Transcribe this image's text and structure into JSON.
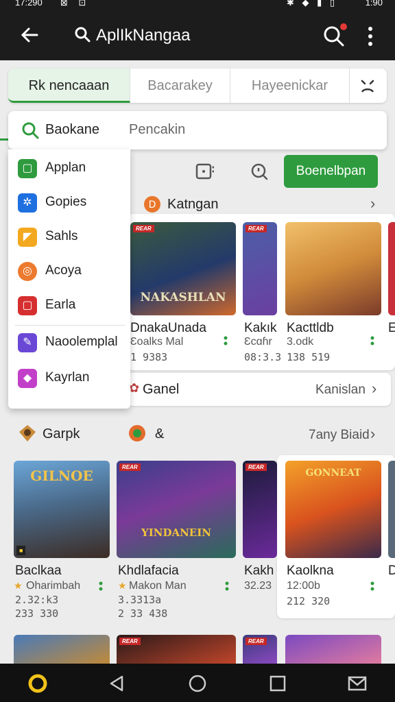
{
  "status": {
    "time_left": "17:290",
    "time_right": "1:90",
    "icons_left": "⊠ ⊡",
    "icons_right": "✱ ◆ ▮ ▯"
  },
  "app_bar": {
    "title": "AplIkNangaa"
  },
  "tabs": [
    "Rk nencaaan",
    "Bacarakey",
    "Hayeenickar"
  ],
  "search": {
    "chip": "Baokane",
    "placeholder": "Pencakin"
  },
  "dropdown": [
    {
      "label": "Applan",
      "color": "#2e9b3e",
      "icon": "square-icon"
    },
    {
      "label": "Gopies",
      "color": "#1e6fe0",
      "icon": "puzzle-icon"
    },
    {
      "label": "Sahls",
      "color": "#f3a91f",
      "icon": "play-icon"
    },
    {
      "label": "Acoya",
      "color": "#ec7a2f",
      "icon": "circle-icon"
    },
    {
      "label": "Earla",
      "color": "#d62f2f",
      "icon": "square-icon"
    },
    {
      "label": "Naoolemplal",
      "color": "#6b47d6",
      "icon": "pen-icon"
    },
    {
      "label": "Kayrlan",
      "color": "#c23fc9",
      "icon": "diamond-icon"
    }
  ],
  "go_button": "Boenelbpan",
  "section1": {
    "title": "Katngan",
    "cards": [
      {
        "name": "DnakaUnada",
        "sub": "Ɛoalks Mal",
        "num": "1 9383",
        "logo": "NAKASHLAN",
        "badge": "REAR"
      },
      {
        "name": "Kakık",
        "sub": "Ɛcɑɦr",
        "num": "08:3.3",
        "logo": "",
        "badge": "REAR"
      },
      {
        "name": "Kacttldb",
        "sub": "3.odk",
        "num": "138 519",
        "logo": "",
        "badge": ""
      },
      {
        "name": "E",
        "sub": "",
        "num": "",
        "logo": "",
        "badge": ""
      }
    ]
  },
  "section_bar": {
    "title": "Ganel",
    "more": "Kanislan"
  },
  "section2": {
    "title": "Garpk",
    "title2": "&",
    "more": "7any Biaid",
    "cards": [
      {
        "name": "Baclkaa",
        "sub": "Oharimbah",
        "num": "2.32:k3",
        "num2": "233 330",
        "logo": "GILNOE"
      },
      {
        "name": "Khdlafacia",
        "sub": "Makon Man",
        "num": "3.3313a",
        "num2": "2 33 438",
        "logo": "YINDANEIN"
      },
      {
        "name": "Kakh",
        "sub": "32.23",
        "num": "",
        "num2": "",
        "logo": ""
      },
      {
        "name": "Kaolkna",
        "sub": "12:00b",
        "num": "212 320",
        "num2": "",
        "logo": "GONNEAT"
      },
      {
        "name": "D",
        "sub": "",
        "num": "",
        "num2": "",
        "logo": ""
      }
    ]
  },
  "nav": [
    "home",
    "back",
    "home-circle",
    "recents",
    "mail"
  ]
}
